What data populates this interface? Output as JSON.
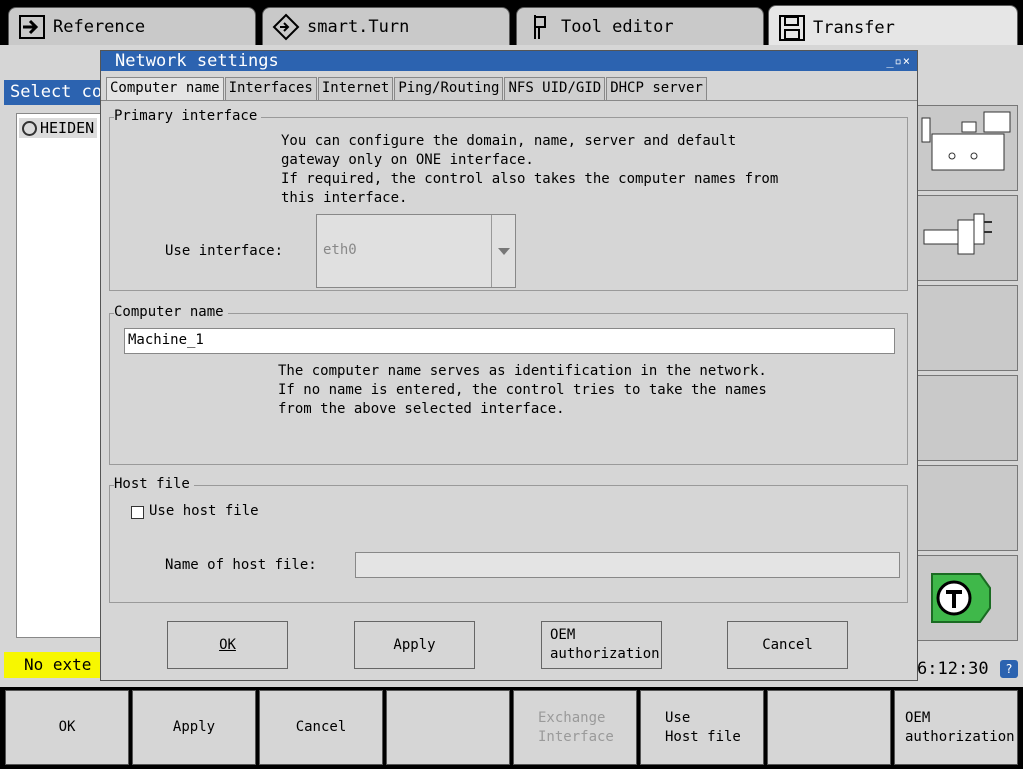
{
  "mode_tabs": [
    {
      "label": "Reference",
      "icon": "arrow-into-box-icon"
    },
    {
      "label": "smart.Turn",
      "icon": "diamond-arrow-icon"
    },
    {
      "label": "Tool editor",
      "icon": "tool-holder-icon"
    },
    {
      "label": "Transfer",
      "icon": "floppy-disk-icon"
    }
  ],
  "background": {
    "select_label": "Select co",
    "file_item": "HEIDEN",
    "status_message": "No exte",
    "time": "6:12:30",
    "help_label": "?"
  },
  "dialog": {
    "title": "Network settings",
    "window_controls": "_▫×",
    "tabs": [
      "Computer name",
      "Interfaces",
      "Internet",
      "Ping/Routing",
      "NFS UID/GID",
      "DHCP server"
    ],
    "primary_interface": {
      "title": "Primary interface",
      "note": "You can configure the domain, name, server and default\ngateway only on ONE interface.\nIf required, the control also takes the computer names from\nthis interface.",
      "use_interface_label": "Use interface:",
      "use_interface_value": "eth0"
    },
    "computer_name": {
      "title": "Computer name",
      "value": "Machine_1",
      "note": "The computer name serves as identification in the network.\nIf no name is entered, the control tries to take the names\nfrom the above selected interface."
    },
    "host_file": {
      "title": "Host file",
      "checkbox_label": "Use host file",
      "checked": false,
      "name_label": "Name of host file:",
      "name_value": ""
    },
    "buttons": {
      "ok": "OK",
      "apply": "Apply",
      "oem": "OEM\nauthorization",
      "cancel": "Cancel"
    }
  },
  "softkeys": [
    {
      "label": "OK",
      "enabled": true
    },
    {
      "label": "Apply",
      "enabled": true
    },
    {
      "label": "Cancel",
      "enabled": true
    },
    {
      "label": "",
      "enabled": true
    },
    {
      "label": "Exchange\nInterface",
      "enabled": false
    },
    {
      "label": "Use\nHost file",
      "enabled": true
    },
    {
      "label": "",
      "enabled": true
    },
    {
      "label": "OEM\nauthorization",
      "enabled": true
    }
  ]
}
